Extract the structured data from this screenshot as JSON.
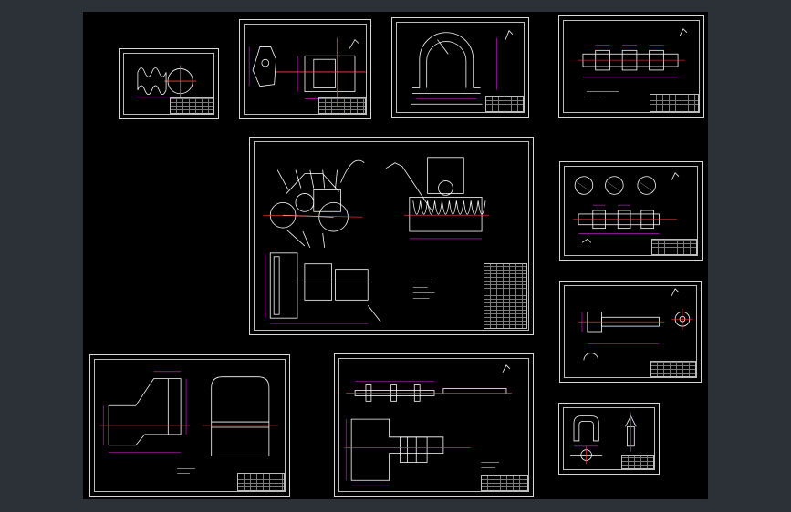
{
  "viewer": {
    "background_color": "#2c3138",
    "canvas_color": "#000000",
    "line_color": "#ffffff",
    "dimension_color": "#e020e0",
    "center_line_color": "#ff4040"
  },
  "sheets": [
    {
      "id": "sheet-1",
      "title_block_icon": "title-block"
    },
    {
      "id": "sheet-2",
      "title_block_icon": "title-block"
    },
    {
      "id": "sheet-3",
      "title_block_icon": "title-block"
    },
    {
      "id": "sheet-4",
      "title_block_icon": "title-block"
    },
    {
      "id": "sheet-5-main-assembly",
      "title_block_icon": "title-block"
    },
    {
      "id": "sheet-6",
      "title_block_icon": "title-block"
    },
    {
      "id": "sheet-7",
      "title_block_icon": "title-block"
    },
    {
      "id": "sheet-8",
      "title_block_icon": "title-block"
    },
    {
      "id": "sheet-9",
      "title_block_icon": "title-block"
    },
    {
      "id": "sheet-10",
      "title_block_icon": "title-block"
    }
  ]
}
